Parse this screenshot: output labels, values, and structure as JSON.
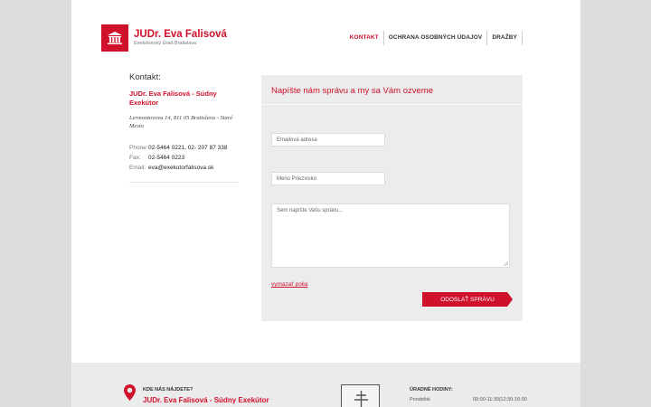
{
  "brand": {
    "name": "JUDr. Eva Falisová",
    "subtitle": "Exekútorský Úrad Bratislava",
    "color": "#d0112b",
    "icon": "courthouse-icon"
  },
  "nav": {
    "items": [
      "KONTAKT",
      "OCHRANA OSOBNÝCH ÚDAJOV",
      "DRAŽBY"
    ],
    "active": "KONTAKT"
  },
  "contact": {
    "heading": "Kontakt:",
    "firm": "JUDr. Eva Falisová - Súdny Exekútor",
    "address": "Lermontovova 14, 811 05 Bratislava - Staré Mesto",
    "phone_label": "Phone:",
    "phone": "02-5464 0221, 02- 207 87 338",
    "fax_label": "Fax:",
    "fax": "02-5464 0223",
    "email_label": "Email:",
    "email": "eva@exekutorfalisova.sk"
  },
  "form": {
    "heading": "Napíšte nám správu a my sa Vám ozveme",
    "email_placeholder": "Emailová adresa",
    "name_placeholder": "Meno Priezvisko",
    "message_placeholder": "Sem napíšte Vašu správu...",
    "clear_label": "vymazať polia",
    "submit_label": "ODOSLAŤ SPRÁVU"
  },
  "footer": {
    "find_label": "KDE NÁS NÁJDETE?",
    "firm": "JUDr. Eva Falisová - Súdny Exekútor",
    "hours_label": "ÚRADNÉ HODINY:",
    "day": "Pondelok",
    "time": "09:00-11:30|12:30-16:00",
    "pin_icon": "location-pin-icon",
    "emblem_icon": "coat-of-arms-icon"
  }
}
